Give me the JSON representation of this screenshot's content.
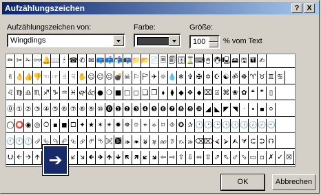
{
  "dialog": {
    "title": "Aufzählungszeichen",
    "help_label": "?",
    "close_label": "X"
  },
  "font": {
    "label": "Aufzählungszeichen von:",
    "value": "Wingdings"
  },
  "color": {
    "label": "Farbe:",
    "swatch": "#404040"
  },
  "size": {
    "label": "Größe:",
    "value": "100",
    "suffix": "% vom Text"
  },
  "symbols": [
    "✏✂✁👓🔔📖🕯☎✆✉📪📫📬📭📁📂📄🗏🗐🗄⌛⌨🖱🖲🖳🖴🖫🖬✍",
    "✌👌👍👎☜☞☝☟✋☺😐☹💣☠⚐🏱✈☼💧❄✞✠✡☪☯ॐ☸♈♉♊♋",
    "♌♍♎♏♐♑♒♓🙰🙵●❍■□◻❑❒⬧⧫◆❖⬥⌧⍓⌘❀✿❝❞▯",
    "⓪①②③④⑤⑥⑦⑧⑨⑩⓿❶❷❸❹❺❻❼❽❾❿◢◣◤◥·•▪⚪",
    "◯⭕◉◎🞅▪◼🞏✦★✶✴✹✵⯐⌖⟡⌑⯑✪✰🕐🕑🕒🕓🕔🕕🕖🕗🕘",
    "🕙🕚🕛⮰⮱⮲⮳⮴⮵⮶⮷🙪🙫🙕🙔🙗🙖🙐🙑🙒🙓⌫⌦⮘⮚⮙⮛⮈⮊⮉",
    "⮋🡨🡪🡩🡫🡬🡭🡯🡮🡸🡺🡹🡻🡼🡽🡿🡾⇦⇨⇧⇩⬄⇳⬀⬁⬃⬂▭▫✗✓☒"
  ],
  "preview_glyph": "➔",
  "buttons": {
    "ok": "OK",
    "cancel": "Abbrechen"
  }
}
